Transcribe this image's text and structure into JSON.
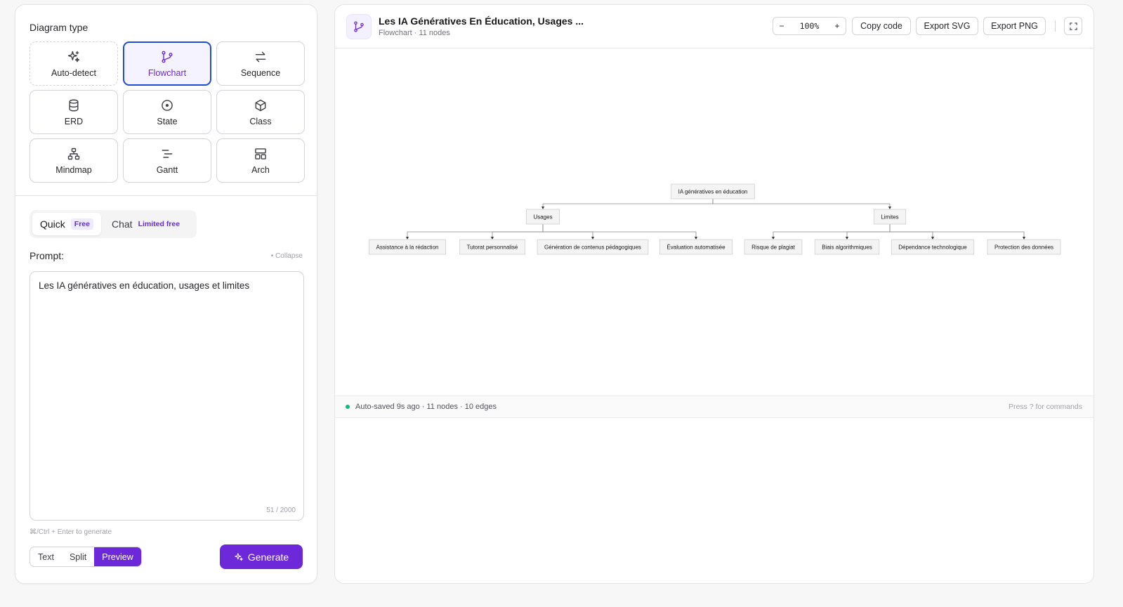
{
  "diagram_type": {
    "title": "Diagram type",
    "options": [
      {
        "label": "Auto-detect",
        "icon": "sparkles-icon"
      },
      {
        "label": "Flowchart",
        "icon": "git-branch-icon",
        "selected": true
      },
      {
        "label": "Sequence",
        "icon": "arrows-swap-icon"
      },
      {
        "label": "ERD",
        "icon": "database-icon"
      },
      {
        "label": "State",
        "icon": "circle-dot-icon"
      },
      {
        "label": "Class",
        "icon": "box-icon"
      },
      {
        "label": "Mindmap",
        "icon": "network-icon"
      },
      {
        "label": "Gantt",
        "icon": "gantt-bars-icon"
      },
      {
        "label": "Arch",
        "icon": "layout-grid-icon"
      }
    ]
  },
  "mode_tabs": {
    "quick": {
      "label": "Quick",
      "badge": "Free"
    },
    "chat": {
      "label": "Chat",
      "badge": "Limited free"
    }
  },
  "prompt": {
    "label": "Prompt:",
    "collapse": "• Collapse",
    "value": "Les IA génératives en éducation, usages et limites",
    "char_count": "51 / 2000",
    "hint": "⌘/Ctrl + Enter to generate"
  },
  "view_modes": [
    "Text",
    "Split",
    "Preview"
  ],
  "active_view": "Preview",
  "generate_label": "Generate",
  "header": {
    "title": "Les IA Génératives En Éducation, Usages ...",
    "subtitle": "Flowchart · 11 nodes",
    "zoom": {
      "minus": "−",
      "value": "100%",
      "plus": "+"
    },
    "copy_code": "Copy code",
    "export_svg": "Export SVG",
    "export_png": "Export PNG"
  },
  "diagram": {
    "root": "IA génératives en éducation",
    "branches": [
      {
        "label": "Usages",
        "children": [
          "Assistance à la rédaction",
          "Tutorat personnalisé",
          "Génération de contenus pédagogiques",
          "Évaluation automatisée"
        ]
      },
      {
        "label": "Limites",
        "children": [
          "Risque de plagiat",
          "Biais algorithmiques",
          "Dépendance technologique",
          "Protection des données"
        ]
      }
    ]
  },
  "status": {
    "text": "Auto-saved 9s ago · 11 nodes · 10 edges",
    "hint": "Press ? for commands"
  },
  "colors": {
    "accent": "#6d28d9",
    "selected_border": "#1d4ed8",
    "success": "#10b981"
  }
}
